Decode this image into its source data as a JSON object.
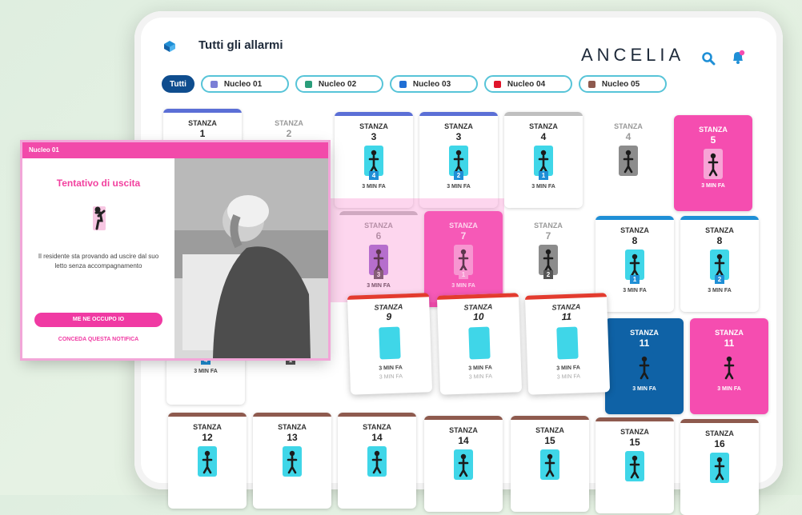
{
  "header": {
    "title": "Tutti gli allarmi",
    "brand": "ANCELIA"
  },
  "filters": [
    {
      "label": "Tutti",
      "color": "",
      "active": true
    },
    {
      "label": "Nucleo 01",
      "color": "#7b7fd6"
    },
    {
      "label": "Nucleo 02",
      "color": "#2a9d7a"
    },
    {
      "label": "Nucleo 03",
      "color": "#1f6ed4"
    },
    {
      "label": "Nucleo 04",
      "color": "#e0142a"
    },
    {
      "label": "Nucleo 05",
      "color": "#8e5a4e"
    }
  ],
  "room_label": "STANZA",
  "ago_label": "3 MIN FA",
  "rooms": [
    {
      "num": "1",
      "tag": "",
      "ago": ""
    },
    {
      "num": "2",
      "tag": "",
      "ago": ""
    },
    {
      "num": "3",
      "tag": "4",
      "ago": "3 MIN FA"
    },
    {
      "num": "3",
      "tag": "2",
      "ago": "3 MIN FA"
    },
    {
      "num": "4",
      "tag": "1",
      "ago": "3 MIN FA"
    },
    {
      "num": "4",
      "tag": "",
      "ago": ""
    },
    {
      "num": "5",
      "tag": "",
      "ago": "3 MIN FA"
    },
    {
      "num": "6",
      "tag": "3",
      "ago": "3 MIN FA"
    },
    {
      "num": "7",
      "tag": "1",
      "ago": "3 MIN FA"
    },
    {
      "num": "7",
      "tag": "2",
      "ago": ""
    },
    {
      "num": "8",
      "tag": "1",
      "ago": "3 MIN FA"
    },
    {
      "num": "8",
      "tag": "2",
      "ago": "3 MIN FA"
    },
    {
      "num": "11",
      "tag": "",
      "ago": "3 MIN FA"
    },
    {
      "num": "11",
      "tag": "",
      "ago": "3 MIN FA"
    },
    {
      "num": "",
      "tag": "4",
      "ago": "3 MIN FA"
    },
    {
      "num": "",
      "tag": "1",
      "ago": ""
    },
    {
      "num": "12",
      "tag": "",
      "ago": ""
    },
    {
      "num": "13",
      "tag": "",
      "ago": ""
    },
    {
      "num": "14",
      "tag": "",
      "ago": ""
    },
    {
      "num": "14",
      "tag": "",
      "ago": ""
    },
    {
      "num": "15",
      "tag": "",
      "ago": ""
    },
    {
      "num": "15",
      "tag": "",
      "ago": ""
    },
    {
      "num": "16",
      "tag": "",
      "ago": ""
    }
  ],
  "front_rooms": [
    {
      "num": "9",
      "ago": "3 MIN FA",
      "ago2": "3 MIN FA"
    },
    {
      "num": "10",
      "ago": "3 MIN FA",
      "ago2": "3 MIN FA"
    },
    {
      "num": "11",
      "ago": "3 MIN FA",
      "ago2": "3 MIN FA"
    }
  ],
  "popup": {
    "header": "Nucleo 01",
    "title": "Tentativo di uscita",
    "description": "Il residente sta provando ad uscire dal suo letto senza accompagnamento",
    "primary_button": "ME NE OCCUPO IO",
    "secondary_link": "CONCEDA QUESTA NOTIFICA"
  },
  "colors": {
    "teal": "#3fd6e8",
    "pink": "#f54db0",
    "navy": "#0f62a6",
    "bar_blue": "#5b6fd6",
    "bar_red": "#e33b2e",
    "bar_brown": "#8e5a4e",
    "bar_grey": "#bfbfbf"
  }
}
